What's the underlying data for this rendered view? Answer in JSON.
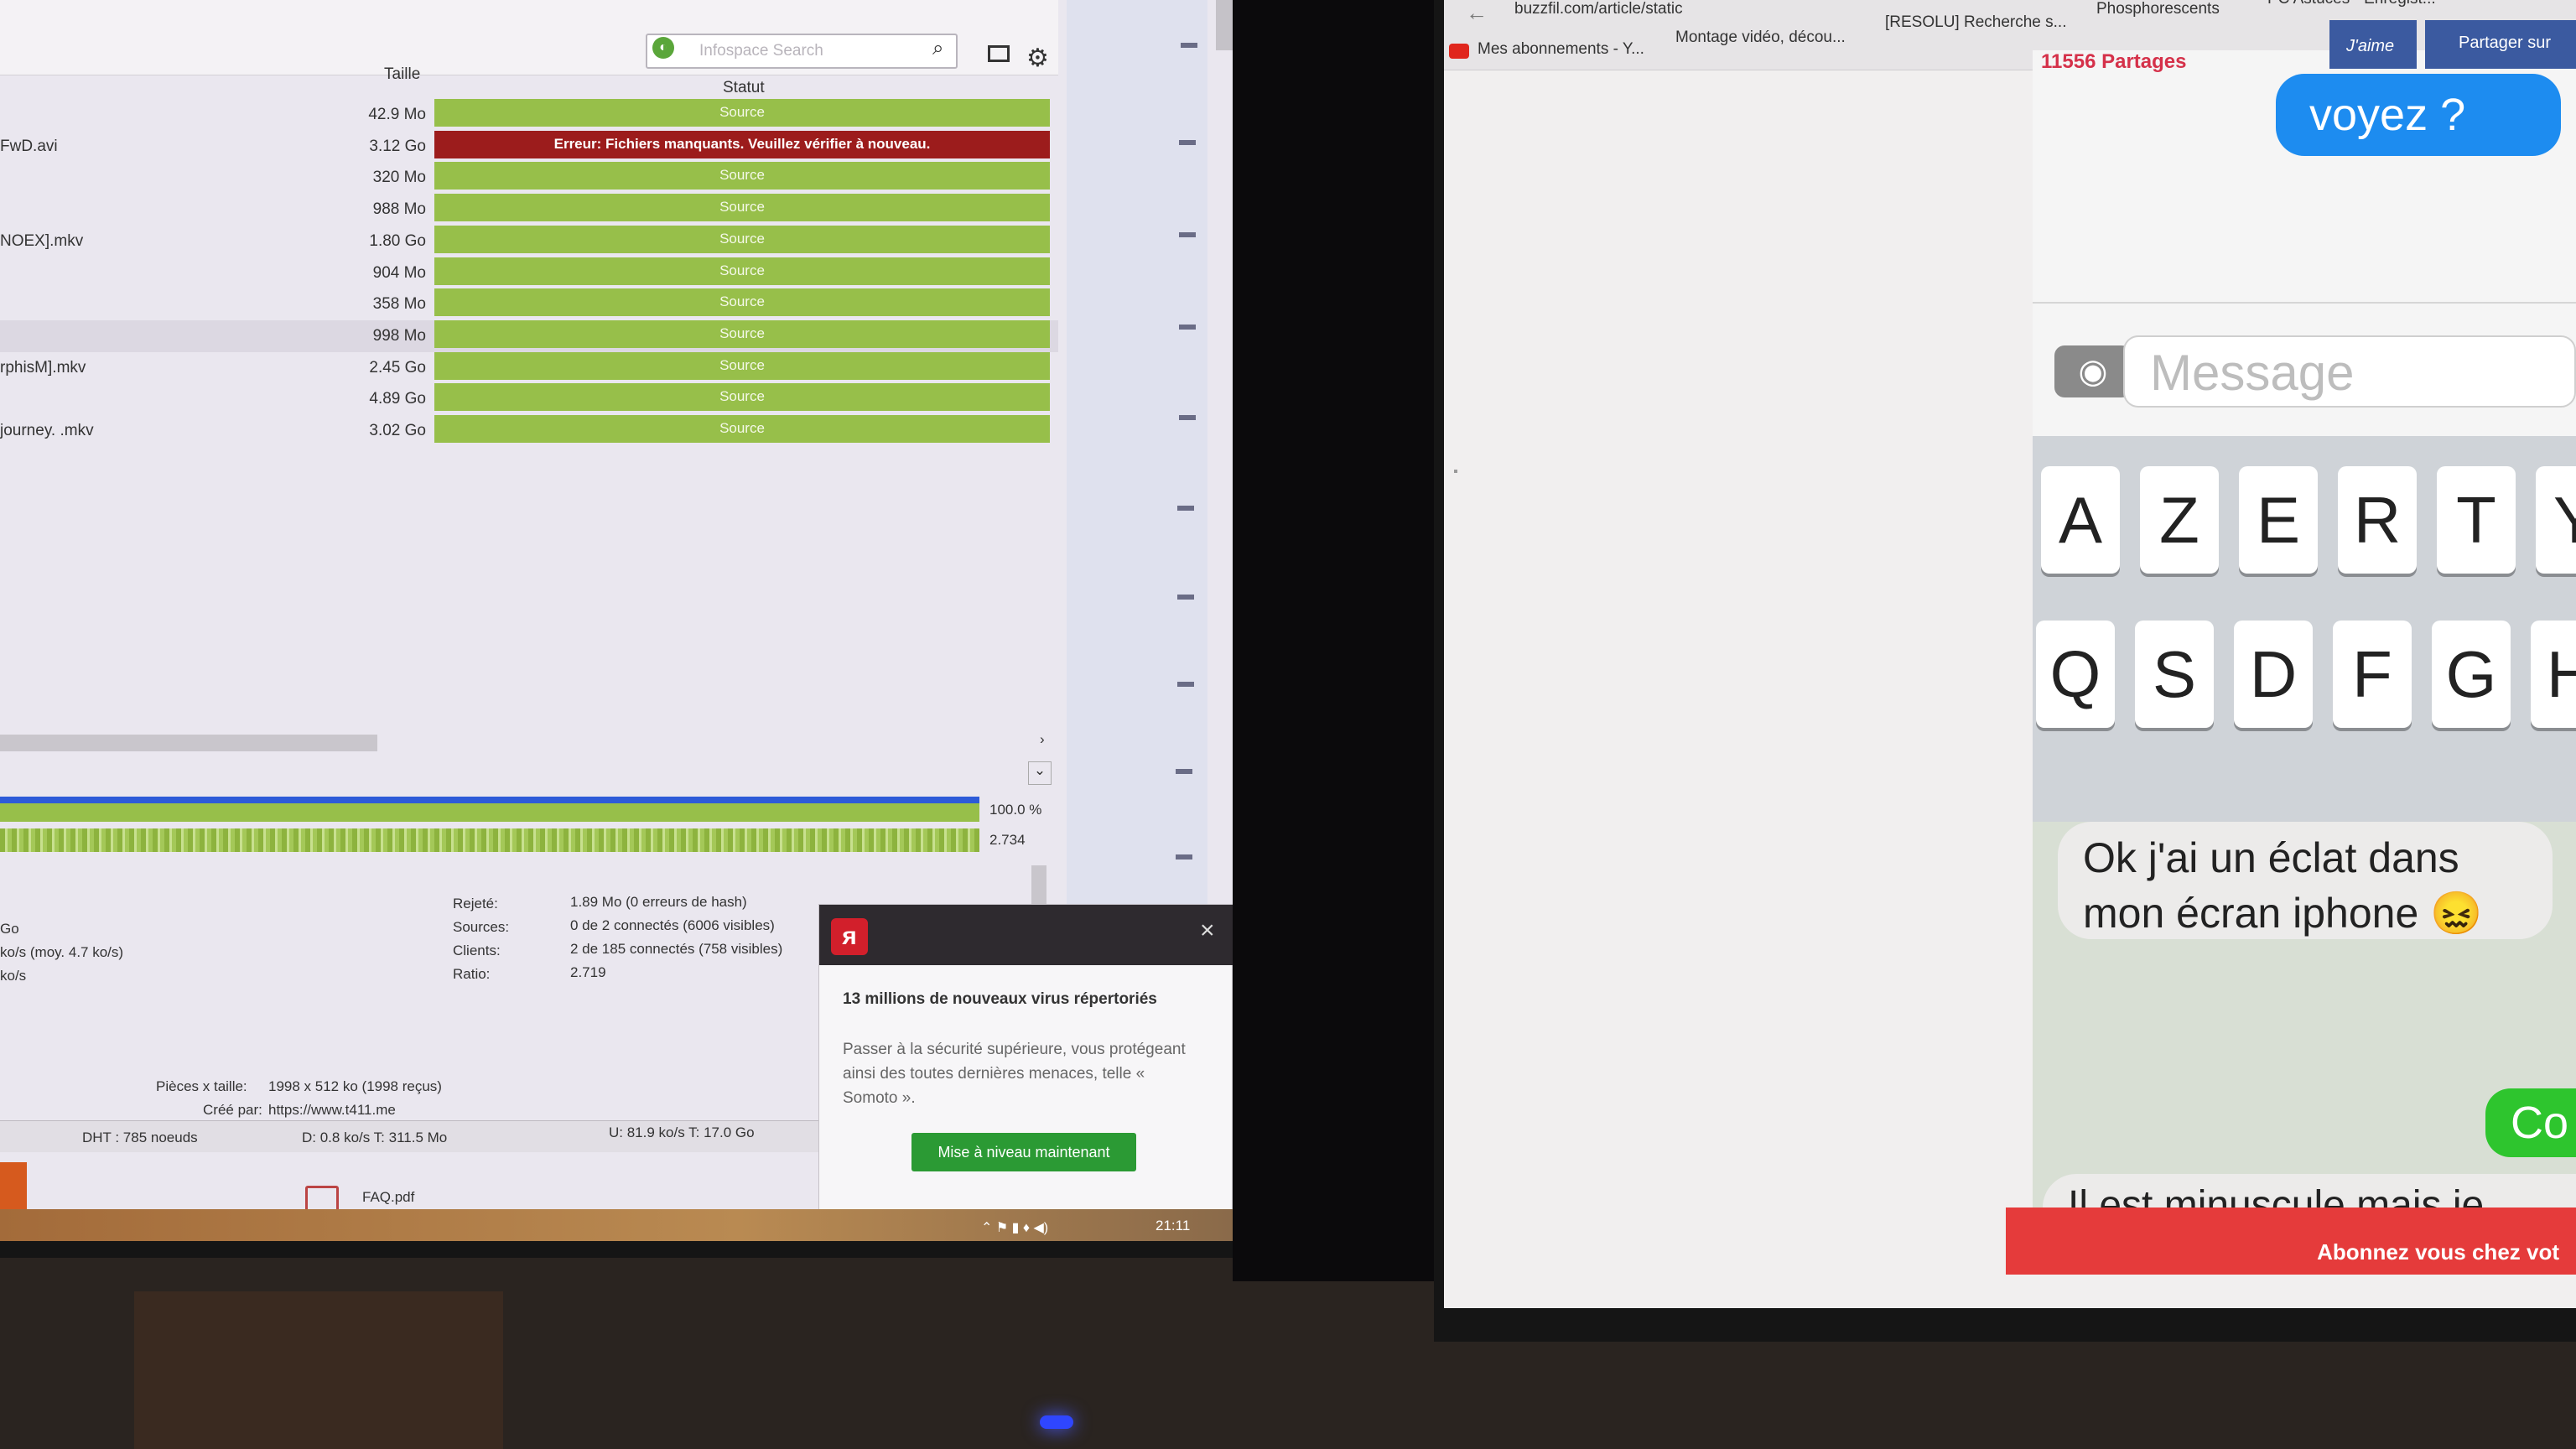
{
  "left": {
    "search": {
      "placeholder": "Infospace Search"
    },
    "headers": {
      "size": "Taille",
      "status": "Statut"
    },
    "rows": [
      {
        "name": "",
        "size": "42.9 Mo",
        "status": "Source",
        "error": false
      },
      {
        "name": "FwD.avi",
        "size": "3.12 Go",
        "status": "Erreur: Fichiers manquants. Veuillez vérifier à nouveau.",
        "error": true
      },
      {
        "name": "",
        "size": "320 Mo",
        "status": "Source",
        "error": false
      },
      {
        "name": "",
        "size": "988 Mo",
        "status": "Source",
        "error": false
      },
      {
        "name": "NOEX].mkv",
        "size": "1.80 Go",
        "status": "Source",
        "error": false
      },
      {
        "name": "",
        "size": "904 Mo",
        "status": "Source",
        "error": false
      },
      {
        "name": "",
        "size": "358 Mo",
        "status": "Source",
        "error": false
      },
      {
        "name": "",
        "size": "998 Mo",
        "status": "Source",
        "error": false
      },
      {
        "name": "rphisM].mkv",
        "size": "2.45 Go",
        "status": "Source",
        "error": false
      },
      {
        "name": "",
        "size": "4.89 Go",
        "status": "Source",
        "error": false
      },
      {
        "name": "journey. .mkv",
        "size": "3.02 Go",
        "status": "Source",
        "error": false
      }
    ],
    "progress": {
      "percent": "100.0 %",
      "ratio": "2.734"
    },
    "stats_left": [
      "Go",
      "ko/s (moy. 4.7 ko/s)",
      "ko/s"
    ],
    "stats": [
      {
        "label": "Rejeté:",
        "value": "1.89 Mo (0 erreurs de hash)"
      },
      {
        "label": "Sources:",
        "value": "0 de 2 connectés (6006 visibles)"
      },
      {
        "label": "Clients:",
        "value": "2 de 185 connectés (758 visibles)"
      },
      {
        "label": "Ratio:",
        "value": "2.719"
      }
    ],
    "pieces": {
      "label": "Pièces x taille:",
      "value": "1998 x 512 ko (1998 reçus)"
    },
    "created": {
      "label": "Créé par:",
      "value": "https://www.t411.me"
    },
    "statusbar": {
      "dht": "DHT : 785 noeuds",
      "down": "D: 0.8 ko/s T: 311.5 Mo",
      "up": "U: 81.9 ko/s T: 17.0 Go"
    },
    "file": "FAQ.pdf",
    "clock": "21:11"
  },
  "avira": {
    "title": "13 millions de nouveaux virus répertoriés",
    "body": "Passer à la sécurité supérieure, vous protégeant ainsi des toutes dernières menaces, telle « Somoto ».",
    "button": "Mise à niveau maintenant"
  },
  "right": {
    "url": "buzzfil.com/article/static",
    "bookmarks": [
      "Mes abonnements - Y...",
      "Montage vidéo, décou...",
      "[RESOLU] Recherche s...",
      "Phosphorescents",
      "PC Astuces - Enregist..."
    ],
    "shares": "11556 Partages",
    "like": "J'aime",
    "share_fb": "Partager sur",
    "bubble_top": "voyez ?",
    "message_placeholder": "Message",
    "keys_row1": [
      "A",
      "Z",
      "E",
      "R",
      "T",
      "Y"
    ],
    "keys_row2": [
      "Q",
      "S",
      "D",
      "F",
      "G",
      "H"
    ],
    "chat_gray": "Ok j'ai un éclat dans mon écran iphone 😖",
    "chat_green": "Co",
    "chat_bottom": "Il est minuscule mais je",
    "subscribe": "Abonnez vous chez vot"
  },
  "colors": {
    "green": "#97bf4a",
    "error": "#9c1c1c",
    "ios_blue": "#1d8cf0",
    "avira_red": "#d21f2b"
  }
}
